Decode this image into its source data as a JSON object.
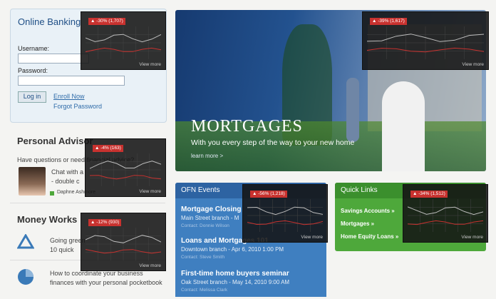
{
  "online_banking": {
    "title": "Online Banking",
    "username_label": "Username:",
    "password_label": "Password:",
    "login_button": "Log in",
    "enroll_link": "Enroll Now",
    "forgot_link": "Forgot Password"
  },
  "personal_advisor": {
    "title": "Personal Advisor",
    "question": "Have questions or need financial advice?",
    "chat_line1": "Chat with a",
    "chat_line2": "- double c",
    "advisor_name": "Daphne Ashmore"
  },
  "money_works": {
    "title": "Money Works",
    "item1_line1": "Going green",
    "item1_line2": "10 quick",
    "item2_line1": "How to coordinate your business",
    "item2_line2": "finances with your personal pocketbook"
  },
  "hero": {
    "heading": "MORTGAGES",
    "subheading": "With you every step of the way to your new home",
    "learn_more": "learn more >"
  },
  "events": {
    "title": "OFN Events",
    "items": [
      {
        "title": "Mortgage Closing",
        "sub": "Main Street branch - M",
        "contact": "Contact: Donnie Wilson"
      },
      {
        "title": "Loans and Mortgages 101",
        "sub": "Downtown branch - Apr 6, 2010  1:00 PM",
        "contact": "Contact: Steve Smith"
      },
      {
        "title": "First-time home buyers seminar",
        "sub": "Oak Street branch - May 14, 2010  9:00 AM",
        "contact": "Contact: Melissa Clark"
      }
    ]
  },
  "quick_links": {
    "title": "Quick Links",
    "items": [
      "Savings Accounts »",
      "Mortgages »",
      "Home Equity Loans »"
    ]
  },
  "overlays": [
    {
      "badge": "▲ -30% (1,707)",
      "view_more": "View more"
    },
    {
      "badge": "▲ -39% (1,617)",
      "view_more": "View more"
    },
    {
      "badge": "▲ -4% (163)",
      "view_more": "View more"
    },
    {
      "badge": "▲ -12% (930)",
      "view_more": "View more"
    },
    {
      "badge": "▲ -56% (1,218)",
      "view_more": "View more"
    },
    {
      "badge": "▲ -34% (1,512)",
      "view_more": "View more"
    }
  ],
  "colors": {
    "accent_blue": "#1f4f86",
    "events_blue": "#3f7fc0",
    "links_green": "#4ea83b",
    "badge_red": "#c8322f"
  }
}
